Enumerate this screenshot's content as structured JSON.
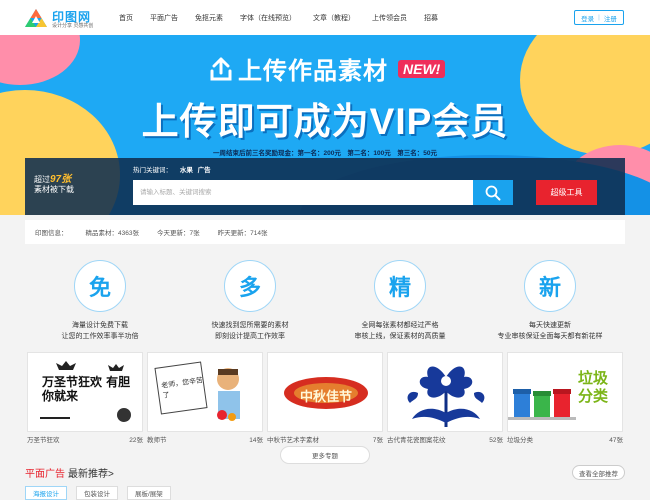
{
  "logo": {
    "name": "印图网",
    "slogan": "设计分享 灵感共创"
  },
  "nav": [
    "首页",
    "平面广告",
    "免抠元素",
    "字体（在线预览）",
    "文章（教程）",
    "上传领会员",
    "招募"
  ],
  "auth": {
    "login": "登录",
    "separator": "|",
    "register": "注册"
  },
  "banner": {
    "upload_title": "上传作品素材",
    "new_badge": "NEW!",
    "vip_title": "上传即可成为VIP会员",
    "prize_text": "一周结束后前三名奖励现金：第一名：200元　第二名：100元　第三名：50元"
  },
  "search": {
    "stat_prefix": "超过",
    "stat_number": "97张",
    "stat_suffix": "素材被下载",
    "hot_label": "热门关键词：",
    "hot_keywords": [
      "水果",
      "广告"
    ],
    "placeholder": "请输入标题、关键词搜索",
    "tool_button": "超级工具"
  },
  "stats": {
    "label": "印图信息：",
    "quality": "精品素材：4363张",
    "today": "今天更新：7张",
    "yesterday": "昨天更新：714张"
  },
  "features": [
    {
      "char": "免",
      "line1": "海量设计免费下载",
      "line2": "让您的工作效率事半功倍"
    },
    {
      "char": "多",
      "line1": "快速找到您所需要的素材",
      "line2": "即刻设计提高工作效率"
    },
    {
      "char": "精",
      "line1": "全网每张素材都经过严格",
      "line2": "审核上线，保证素材的高质量"
    },
    {
      "char": "新",
      "line1": "每天快速更新",
      "line2": "专业审核保证全面每天都有新花样"
    }
  ],
  "thumbs": [
    {
      "title": "万圣节狂欢",
      "count": "22张",
      "art": "万圣节狂欢 有胆你就来"
    },
    {
      "title": "教师节",
      "count": "14张",
      "art": "老师，您辛苦了"
    },
    {
      "title": "中秋节艺术字素材",
      "count": "7张",
      "art": "中秋佳节"
    },
    {
      "title": "古代青花瓷图案花纹",
      "count": "52张",
      "art": ""
    },
    {
      "title": "垃圾分类",
      "count": "47张",
      "art": "垃圾分类"
    }
  ],
  "more_button": "更多专题",
  "section": {
    "title_red": "平面广告",
    "title_dark": "最新推荐>",
    "view_all": "查看全部推荐",
    "tags": [
      "海报设计",
      "包装设计",
      "展板/展架"
    ]
  },
  "colors": {
    "brand_blue": "#1aa3ee",
    "accent_red": "#e8232e",
    "highlight_yellow": "#ffbe2e",
    "banner_blue": "#1ea9f4"
  }
}
